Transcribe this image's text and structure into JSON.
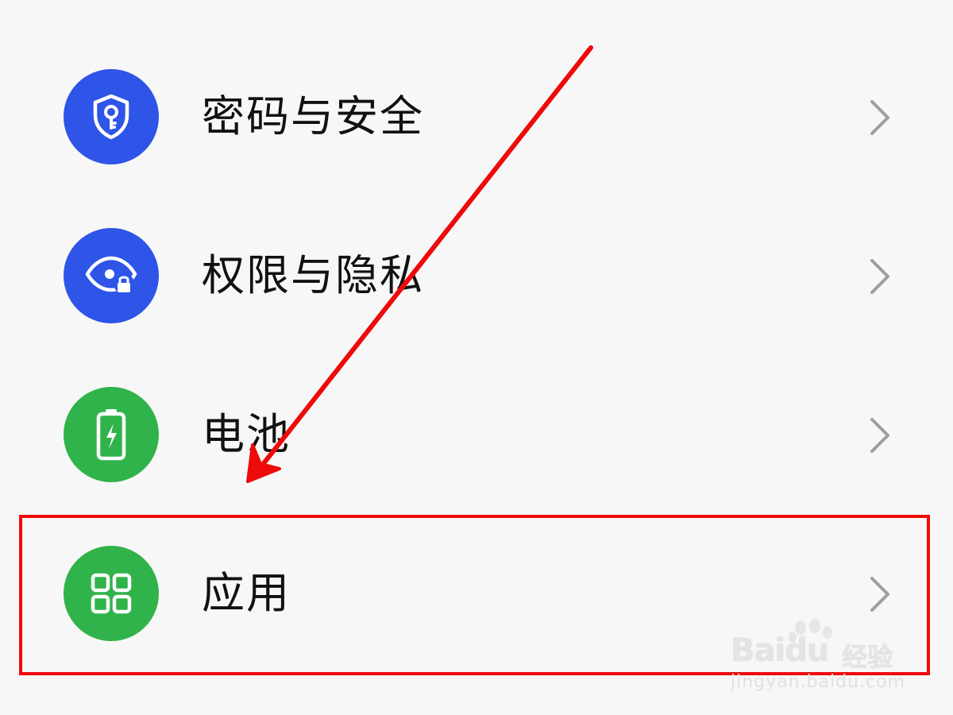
{
  "settings": {
    "items": [
      {
        "label": "密码与安全",
        "icon": "shield-key-icon",
        "color": "#2e55e8"
      },
      {
        "label": "权限与隐私",
        "icon": "eye-lock-icon",
        "color": "#2e55e8"
      },
      {
        "label": "电池",
        "icon": "battery-icon",
        "color": "#2fb34a"
      },
      {
        "label": "应用",
        "icon": "apps-grid-icon",
        "color": "#2fb34a"
      }
    ],
    "chevron_icon": "chevron-right-icon"
  },
  "annotation": {
    "color": "#ee0a0a",
    "highlighted_item": "应用"
  },
  "watermark": {
    "logo": "Baidu",
    "suffix": "经验",
    "url": "jingyan.baidu.com"
  }
}
